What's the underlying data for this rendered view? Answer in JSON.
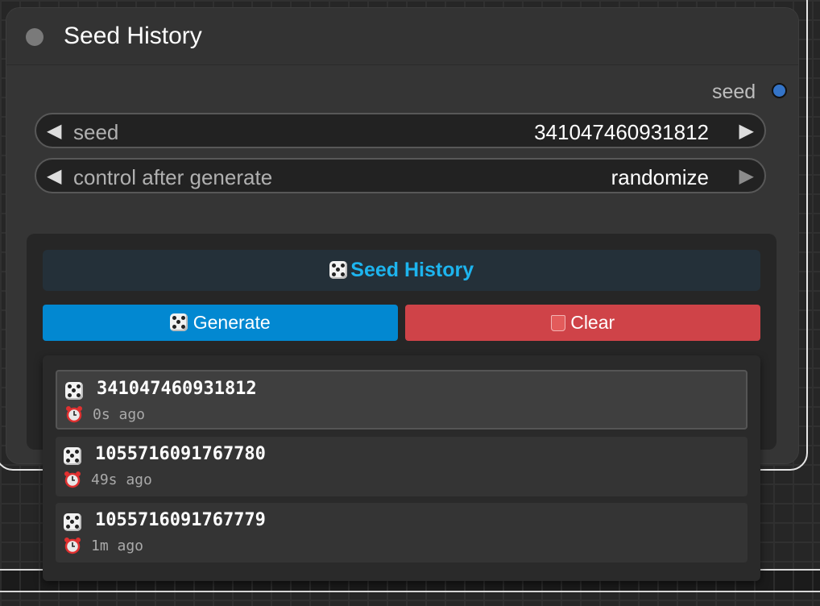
{
  "node": {
    "title": "Seed History",
    "output_label": "seed",
    "widgets": [
      {
        "label": "seed",
        "value": "341047460931812"
      },
      {
        "label": "control after generate",
        "value": "randomize"
      }
    ]
  },
  "history_panel": {
    "title": "Seed History",
    "generate_label": "Generate",
    "clear_label": "Clear",
    "items": [
      {
        "seed": "341047460931812",
        "time": "0s ago",
        "selected": true
      },
      {
        "seed": "1055716091767780",
        "time": "49s ago",
        "selected": false
      },
      {
        "seed": "1055716091767779",
        "time": "1m ago",
        "selected": false
      }
    ]
  },
  "colors": {
    "accent_title": "#1db4ee",
    "generate_button": "#0288d1",
    "clear_button": "#cf4348",
    "output_slot": "#3474c8"
  },
  "icons": [
    "dice-icon",
    "trash-icon",
    "alarm-clock-icon",
    "arrow-left-icon",
    "arrow-right-icon"
  ]
}
